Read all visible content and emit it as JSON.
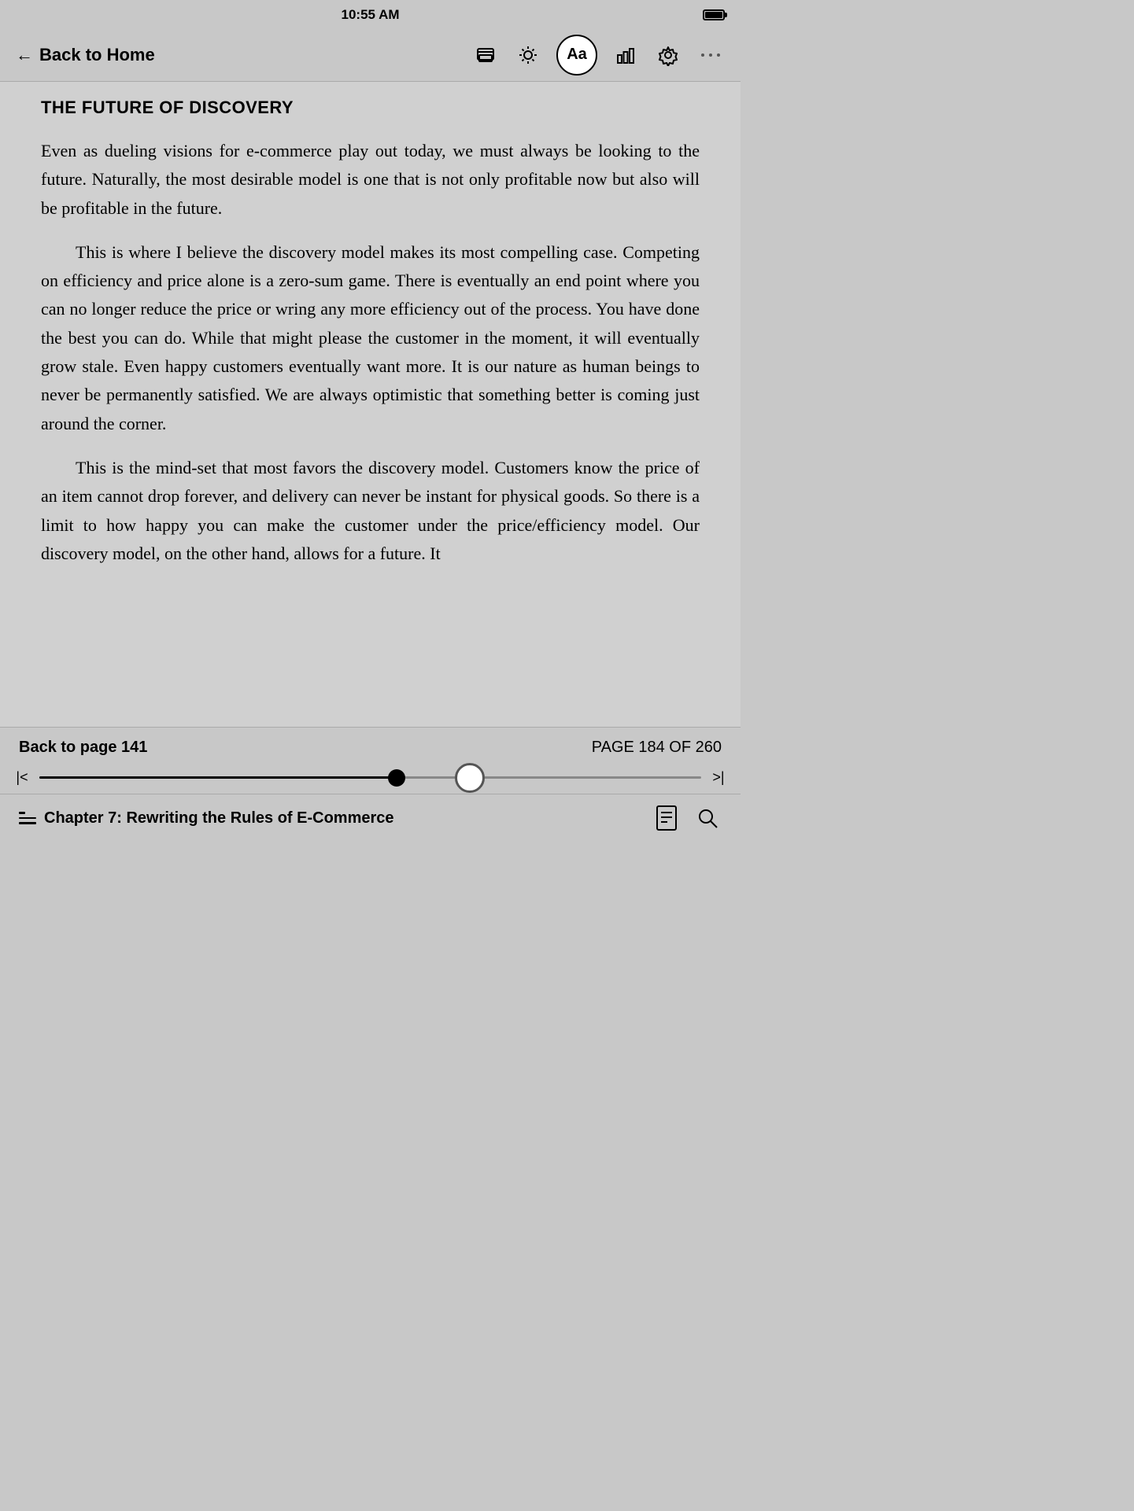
{
  "statusBar": {
    "time": "10:55 AM"
  },
  "navBar": {
    "backLabel": "Back to Home",
    "icons": {
      "cards": "cards-icon",
      "brightness": "brightness-icon",
      "font": "Aa",
      "chart": "chart-icon",
      "settings": "settings-icon",
      "more": "more-icon"
    }
  },
  "content": {
    "chapterTitle": "THE FUTURE OF DISCOVERY",
    "paragraphs": [
      {
        "indent": false,
        "text": "Even as dueling visions for e-commerce play out today, we must always be looking to the future. Naturally, the most desirable model is one that is not only profitable now but also will be profitable in the future."
      },
      {
        "indent": true,
        "text": "This is where I believe the discovery model makes its most compelling case. Competing on efficiency and price alone is a zero-sum game. There is eventually an end point where you can no longer reduce the price or wring any more efficiency out of the process. You have done the best you can do. While that might please the customer in the moment, it will eventually grow stale. Even happy customers eventually want more. It is our nature as human beings to never be permanently satisfied. We are always optimistic that something better is coming just around the corner."
      },
      {
        "indent": true,
        "text": "This is the mind-set that most favors the discovery model. Customers know the price of an item cannot drop forever, and delivery can never be instant for physical goods. So there is a limit to how happy you can make the customer under the price/efficiency model. Our discovery model, on the other hand, allows for a future. It"
      }
    ]
  },
  "bottomNav": {
    "backToPage": "Back to page 141",
    "pageInfo": "PAGE 184 OF 260",
    "sliderProgress": 54,
    "chapterLabel": "Chapter 7: Rewriting the Rules of E-Commerce"
  }
}
